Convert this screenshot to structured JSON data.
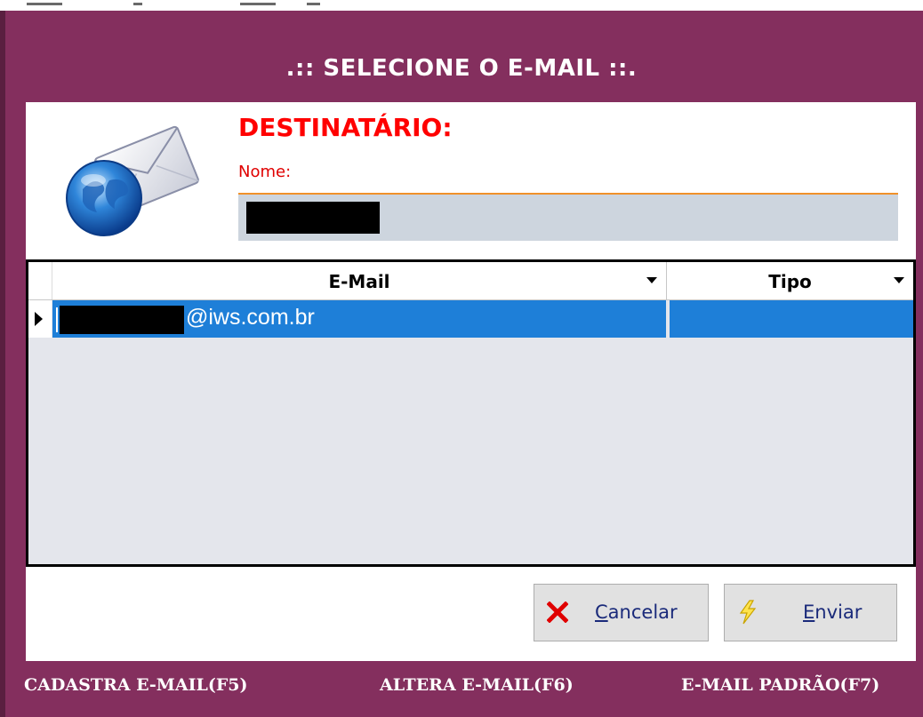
{
  "window": {
    "title": ".:: SELECIONE O E-MAIL ::."
  },
  "recipient": {
    "heading": "DESTINATÁRIO:",
    "name_label": "Nome:",
    "name_value": ""
  },
  "grid": {
    "columns": [
      "E-Mail",
      "Tipo"
    ],
    "rows": [
      {
        "email": "@iws.com.br",
        "tipo": ""
      }
    ],
    "selected_row": 0
  },
  "buttons": {
    "cancel_label": "Cancelar",
    "cancel_mnemonic": "C",
    "cancel_rest": "ancelar",
    "send_label": "Enviar",
    "send_mnemonic": "E",
    "send_rest": "nviar"
  },
  "footer": {
    "items": [
      "CADASTRA E-MAIL(F5)",
      "ALTERA E-MAIL(F6)",
      "E-MAIL PADRÃO(F7)"
    ]
  },
  "colors": {
    "background": "#842f5e",
    "heading_red": "#ff0000",
    "selection_blue": "#1e7fd8",
    "field_grey": "#cdd5de",
    "field_accent": "#f0912a"
  },
  "icons": {
    "recipient": "email-globe-icon",
    "cancel": "red-x-icon",
    "send": "lightning-icon"
  }
}
